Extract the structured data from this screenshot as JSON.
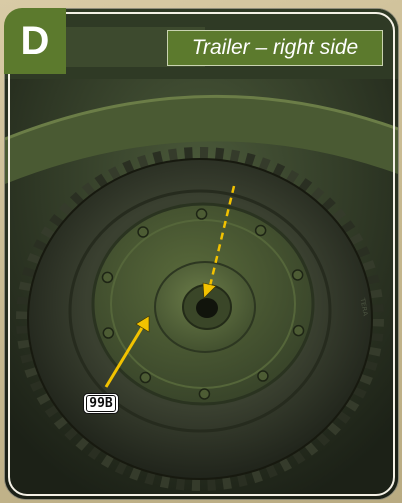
{
  "panel": {
    "letter": "D",
    "caption": "Trailer – right side"
  },
  "callouts": [
    {
      "label": "99B"
    }
  ],
  "colors": {
    "badge_green": "#5c7a2d",
    "arrow_yellow": "#f2c200",
    "tire_rubber": "#2b2f25",
    "rim_green": "#4a5a33"
  },
  "icons": {
    "solid_arrow": "arrow-icon",
    "dashed_arrow": "dashed-arrow-icon"
  }
}
